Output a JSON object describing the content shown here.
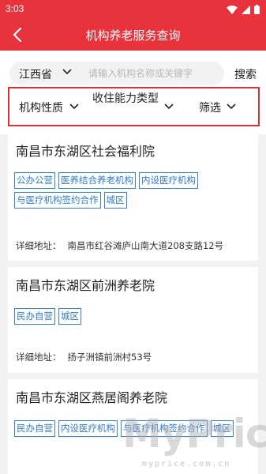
{
  "status_bar": {
    "time": "3:03"
  },
  "app_bar": {
    "title": "机构养老服务查询"
  },
  "search": {
    "province": "江西省",
    "placeholder": "请输入机构名称或关键字",
    "button": "搜索"
  },
  "filters": [
    {
      "label": "机构性质"
    },
    {
      "label": "收住能力类型"
    },
    {
      "label": "筛选"
    }
  ],
  "results": [
    {
      "name": "南昌市东湖区社会福利院",
      "tags": [
        "公办公营",
        "医养结合养老机构",
        "内设医疗机构",
        "与医疗机构签约合作",
        "城区"
      ],
      "address_label": "详细地址：",
      "address": "南昌市红谷滩庐山南大道208支路12号"
    },
    {
      "name": "南昌市东湖区前洲养老院",
      "tags": [
        "民办自营",
        "城区"
      ],
      "address_label": "详细地址：",
      "address": "扬子洲镇前洲村53号"
    },
    {
      "name": "南昌市东湖区燕居阁养老院",
      "tags": [
        "民办自营",
        "内设医疗机构",
        "与医疗机构签约合作",
        "城区"
      ]
    }
  ],
  "watermark": {
    "brand": "MyPrice",
    "url": "myprice.com.cn"
  },
  "colors": {
    "primary": "#e8323c",
    "tag_blue": "#2f7cd2",
    "highlight_border": "#e02f36"
  }
}
